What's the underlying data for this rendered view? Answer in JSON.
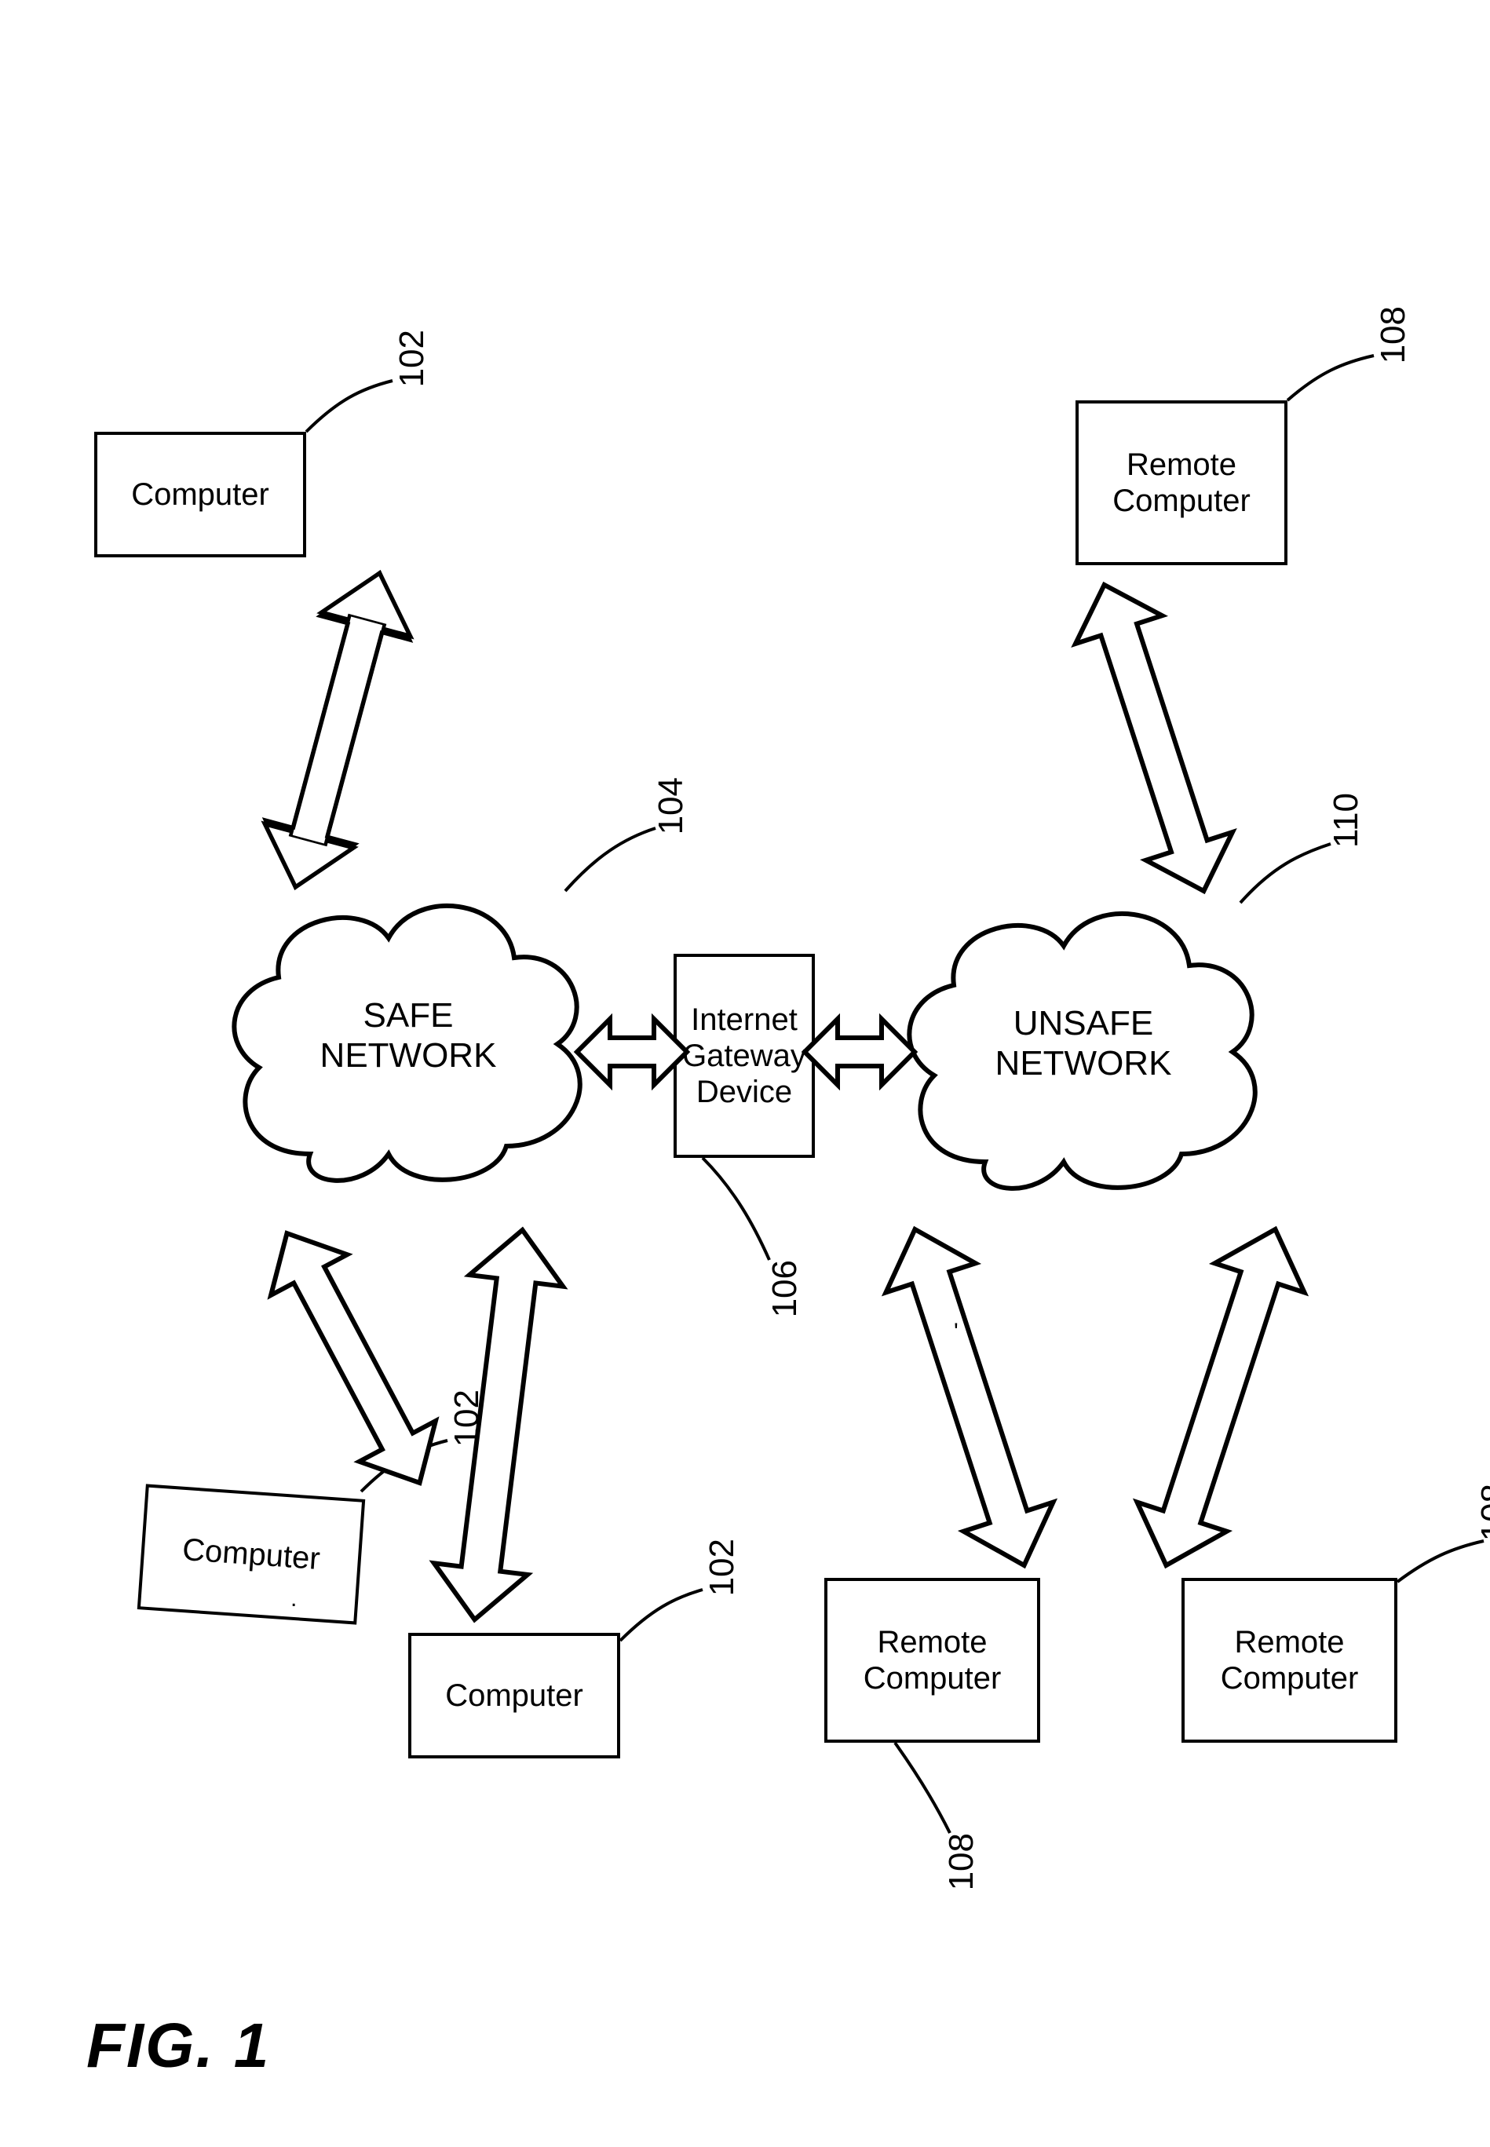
{
  "nodes": {
    "computer1": "Computer",
    "computer2": "Computer",
    "computer3": "Computer",
    "remote1": "Remote\nComputer",
    "remote2": "Remote\nComputer",
    "remote3": "Remote\nComputer",
    "safe_net": "SAFE\nNETWORK",
    "unsafe_net": "UNSAFE\nNETWORK",
    "gateway": "Internet\nGateway\nDevice"
  },
  "refs": {
    "computer_all": "102",
    "safe_net": "104",
    "gateway": "106",
    "remote_all": "108",
    "unsafe_net": "110"
  },
  "figure_label": "FIG. 1"
}
